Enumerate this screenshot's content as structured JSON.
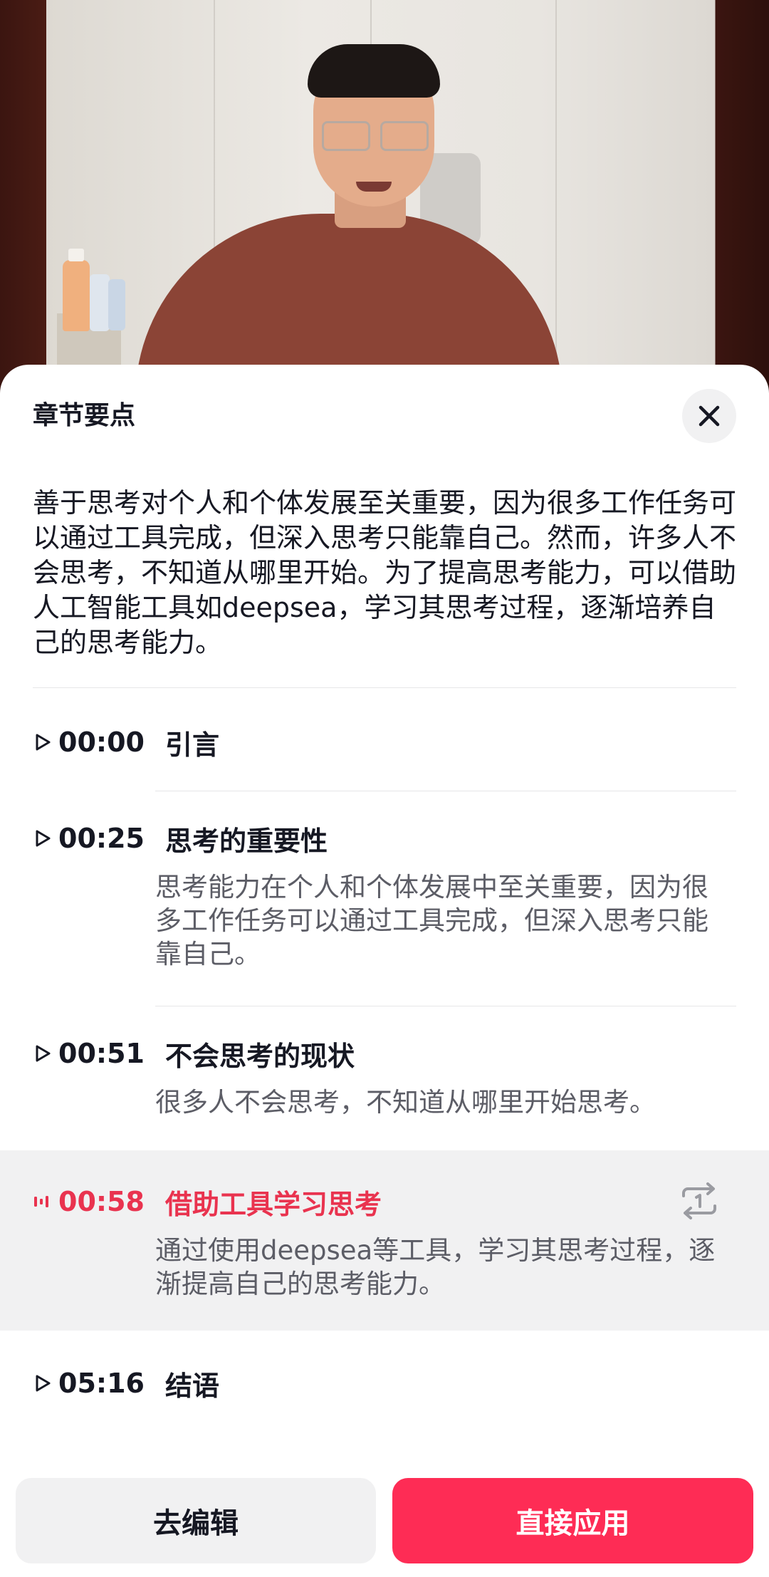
{
  "sheet": {
    "title": "章节要点",
    "close_icon": "close-icon",
    "summary": "善于思考对个人和个体发展至关重要，因为很多工作任务可以通过工具完成，但深入思考只能靠自己。然而，许多人不会思考，不知道从哪里开始。为了提高思考能力，可以借助人工智能工具如deepsea，学习其思考过程，逐渐培养自己的思考能力。"
  },
  "chapters": [
    {
      "time": "00:00",
      "title": "引言",
      "desc": "",
      "icon": "play-icon",
      "active": false
    },
    {
      "time": "00:25",
      "title": "思考的重要性",
      "desc": "思考能力在个人和个体发展中至关重要，因为很多工作任务可以通过工具完成，但深入思考只能靠自己。",
      "icon": "play-icon",
      "active": false
    },
    {
      "time": "00:51",
      "title": "不会思考的现状",
      "desc": "很多人不会思考，不知道从哪里开始思考。",
      "icon": "play-icon",
      "active": false
    },
    {
      "time": "00:58",
      "title": "借助工具学习思考",
      "desc": "通过使用deepsea等工具，学习其思考过程，逐渐提高自己的思考能力。",
      "icon": "playing-bars-icon",
      "active": true,
      "action_icon": "repeat-once-icon"
    },
    {
      "time": "05:16",
      "title": "结语",
      "desc": "",
      "icon": "play-icon",
      "active": false
    }
  ],
  "buttons": {
    "edit_label": "去编辑",
    "apply_label": "直接应用"
  },
  "colors": {
    "accent": "#fe2c55",
    "active_text": "#e9334f",
    "active_row_bg": "#f1f1f2"
  }
}
